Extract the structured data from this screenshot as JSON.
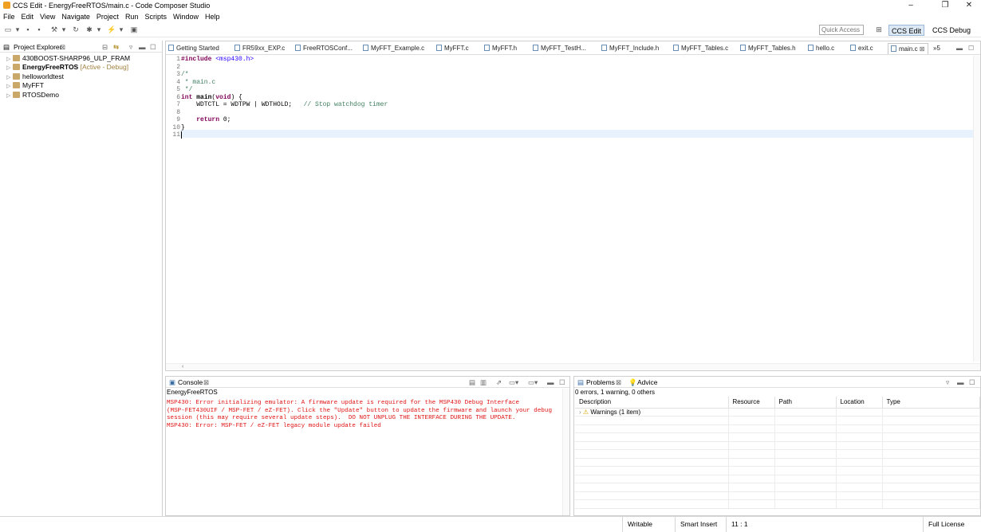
{
  "window": {
    "title": "CCS Edit - EnergyFreeRTOS/main.c - Code Composer Studio",
    "minimize": "–",
    "maximize": "❐",
    "close": "✕"
  },
  "menu": [
    "File",
    "Edit",
    "View",
    "Navigate",
    "Project",
    "Run",
    "Scripts",
    "Window",
    "Help"
  ],
  "toolbar": {
    "quick_access_placeholder": "Quick Access",
    "perspectives": [
      "CCS Edit",
      "CCS Debug"
    ]
  },
  "explorer": {
    "title": "Project Explorer",
    "projects": [
      {
        "name": "430BOOST-SHARP96_ULP_FRAM",
        "tag": ""
      },
      {
        "name": "EnergyFreeRTOS",
        "tag": "[Active - Debug]"
      },
      {
        "name": "helloworldtest",
        "tag": ""
      },
      {
        "name": "MyFFT",
        "tag": ""
      },
      {
        "name": "RTOSDemo",
        "tag": ""
      }
    ]
  },
  "editor": {
    "tabs": [
      "Getting Started",
      "FR59xx_EXP.c",
      "FreeRTOSConf...",
      "MyFFT_Example.c",
      "MyFFT.c",
      "MyFFT.h",
      "MyFFT_TestH...",
      "MyFFT_Include.h",
      "MyFFT_Tables.c",
      "MyFFT_Tables.h",
      "hello.c",
      "exit.c",
      "main.c"
    ],
    "overflow": "»5",
    "active_tab": "main.c",
    "lines": [
      {
        "n": "1",
        "text": "#include <msp430.h>"
      },
      {
        "n": "2",
        "text": ""
      },
      {
        "n": "3",
        "text": "/*"
      },
      {
        "n": "4",
        "text": " * main.c"
      },
      {
        "n": "5",
        "text": " */"
      },
      {
        "n": "6",
        "text": "int main(void) {"
      },
      {
        "n": "7",
        "text": "    WDTCTL = WDTPW | WDTHOLD;   // Stop watchdog timer"
      },
      {
        "n": "8",
        "text": ""
      },
      {
        "n": "9",
        "text": "    return 0;"
      },
      {
        "n": "10",
        "text": "}"
      },
      {
        "n": "11",
        "text": ""
      }
    ]
  },
  "console": {
    "title": "Console",
    "subtitle": "EnergyFreeRTOS",
    "lines": [
      "MSP430: Error initializing emulator: A firmware update is required for the MSP430 Debug Interface",
      "(MSP-FET430UIF / MSP-FET / eZ-FET). Click the \"Update\" button to update the firmware and launch your debug",
      "session (this may require several update steps).  DO NOT UNPLUG THE INTERFACE DURING THE UPDATE.",
      "MSP430: Error: MSP-FET / eZ-FET legacy module update failed"
    ]
  },
  "problems": {
    "tabs": [
      "Problems",
      "Advice"
    ],
    "summary": "0 errors, 1 warning, 0 others",
    "columns": [
      "Description",
      "Resource",
      "Path",
      "Location",
      "Type"
    ],
    "rows": [
      {
        "description": "Warnings (1 item)"
      }
    ]
  },
  "status": {
    "writable": "Writable",
    "insert_mode": "Smart Insert",
    "position": "11 : 1",
    "license": "Full License"
  },
  "colors": {
    "keyword": "#7f0055",
    "comment": "#3f7f5f",
    "string": "#2a00ff",
    "error": "#e01414",
    "current_line": "#e8f2fe"
  }
}
